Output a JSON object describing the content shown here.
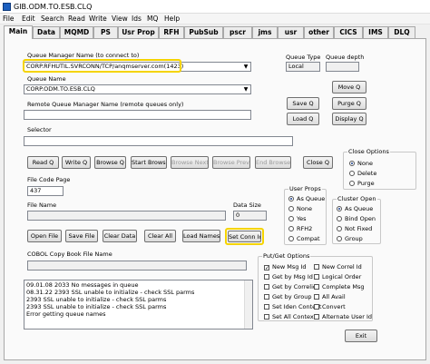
{
  "window": {
    "title": "GIB.ODM.TO.ESB.CLQ"
  },
  "menu": [
    "File",
    "Edit",
    "Search",
    "Read",
    "Write",
    "View",
    "Ids",
    "MQ",
    "Help"
  ],
  "tabs": [
    "Main",
    "Data",
    "MQMD",
    "PS",
    "Usr Prop",
    "RFH",
    "PubSub",
    "pscr",
    "jms",
    "usr",
    "other",
    "CICS",
    "IMS",
    "DLQ"
  ],
  "main": {
    "qm_label": "Queue Manager Name (to connect to)",
    "qm_value": "CORP.RFHUTIL.SVRCONN/TCP/anqmserver.com(1423)",
    "queue_type_label": "Queue Type",
    "queue_type_value": "Local",
    "queue_depth_label": "Queue depth",
    "queue_depth_value": "",
    "queue_name_label": "Queue Name",
    "queue_name_value": "CORP.ODM.TO.ESB.CLQ",
    "remote_qm_label": "Remote Queue Manager Name (remote queues only)",
    "remote_qm_value": "",
    "selector_label": "Selector",
    "selector_value": "",
    "file_code_page_label": "File Code Page",
    "file_code_page_value": "437",
    "file_name_label": "File Name",
    "file_name_value": "",
    "data_size_label": "Data Size",
    "data_size_value": "0",
    "cobol_label": "COBOL Copy Book File Name",
    "cobol_value": ""
  },
  "buttons": {
    "move_q": "Move Q",
    "save_q": "Save Q",
    "purge_q": "Purge Q",
    "load_q": "Load Q",
    "display_q": "Display Q",
    "read_q": "Read Q",
    "write_q": "Write Q",
    "browse_q": "Browse Q",
    "start_browse": "Start Browse",
    "browse_next": "Browse Next",
    "browse_prev": "Browse Prev",
    "end_browse": "End Browse",
    "close_q": "Close Q",
    "open_file": "Open File",
    "save_file": "Save File",
    "clear_data": "Clear Data",
    "clear_all": "Clear All",
    "load_names": "Load Names",
    "set_conn_id": "Set Conn Id",
    "exit": "Exit"
  },
  "close_options": {
    "title": "Close Options",
    "options": [
      "None",
      "Delete",
      "Purge"
    ],
    "selected": 0
  },
  "user_props": {
    "title": "User Props",
    "options": [
      "As Queue",
      "None",
      "Yes",
      "RFH2",
      "Compat"
    ],
    "selected": 0
  },
  "cluster_open": {
    "title": "Cluster Open",
    "options": [
      "As Queue",
      "Bind Open",
      "Not Fixed",
      "Group"
    ],
    "selected": 0
  },
  "put_get": {
    "title": "Put/Get Options",
    "left": [
      "New Msg Id",
      "Get by Msg Id",
      "Get by Correlid",
      "Get by Group Id",
      "Set Iden Context",
      "Set All Context"
    ],
    "right": [
      "New Correl Id",
      "Logical Order",
      "Complete Msg",
      "All Avail",
      "Convert",
      "Alternate User Id"
    ],
    "checked_left": [
      true,
      false,
      false,
      false,
      false,
      false
    ],
    "checked_right": [
      false,
      false,
      false,
      false,
      false,
      false
    ]
  },
  "log": {
    "lines": [
      "09.01.08 2033 No messages in queue",
      "08.31.22 2393 SSL unable to initialize - check SSL parms",
      "2393 SSL unable to initialize - check SSL parms",
      "2393 SSL unable to initialize - check SSL parms",
      "Error getting queue names"
    ]
  },
  "icons": {
    "app": "window-icon",
    "dropdown": "chevron-down-icon"
  },
  "colors": {
    "highlight": "#f5d400",
    "accent": "#1c5fbf"
  }
}
